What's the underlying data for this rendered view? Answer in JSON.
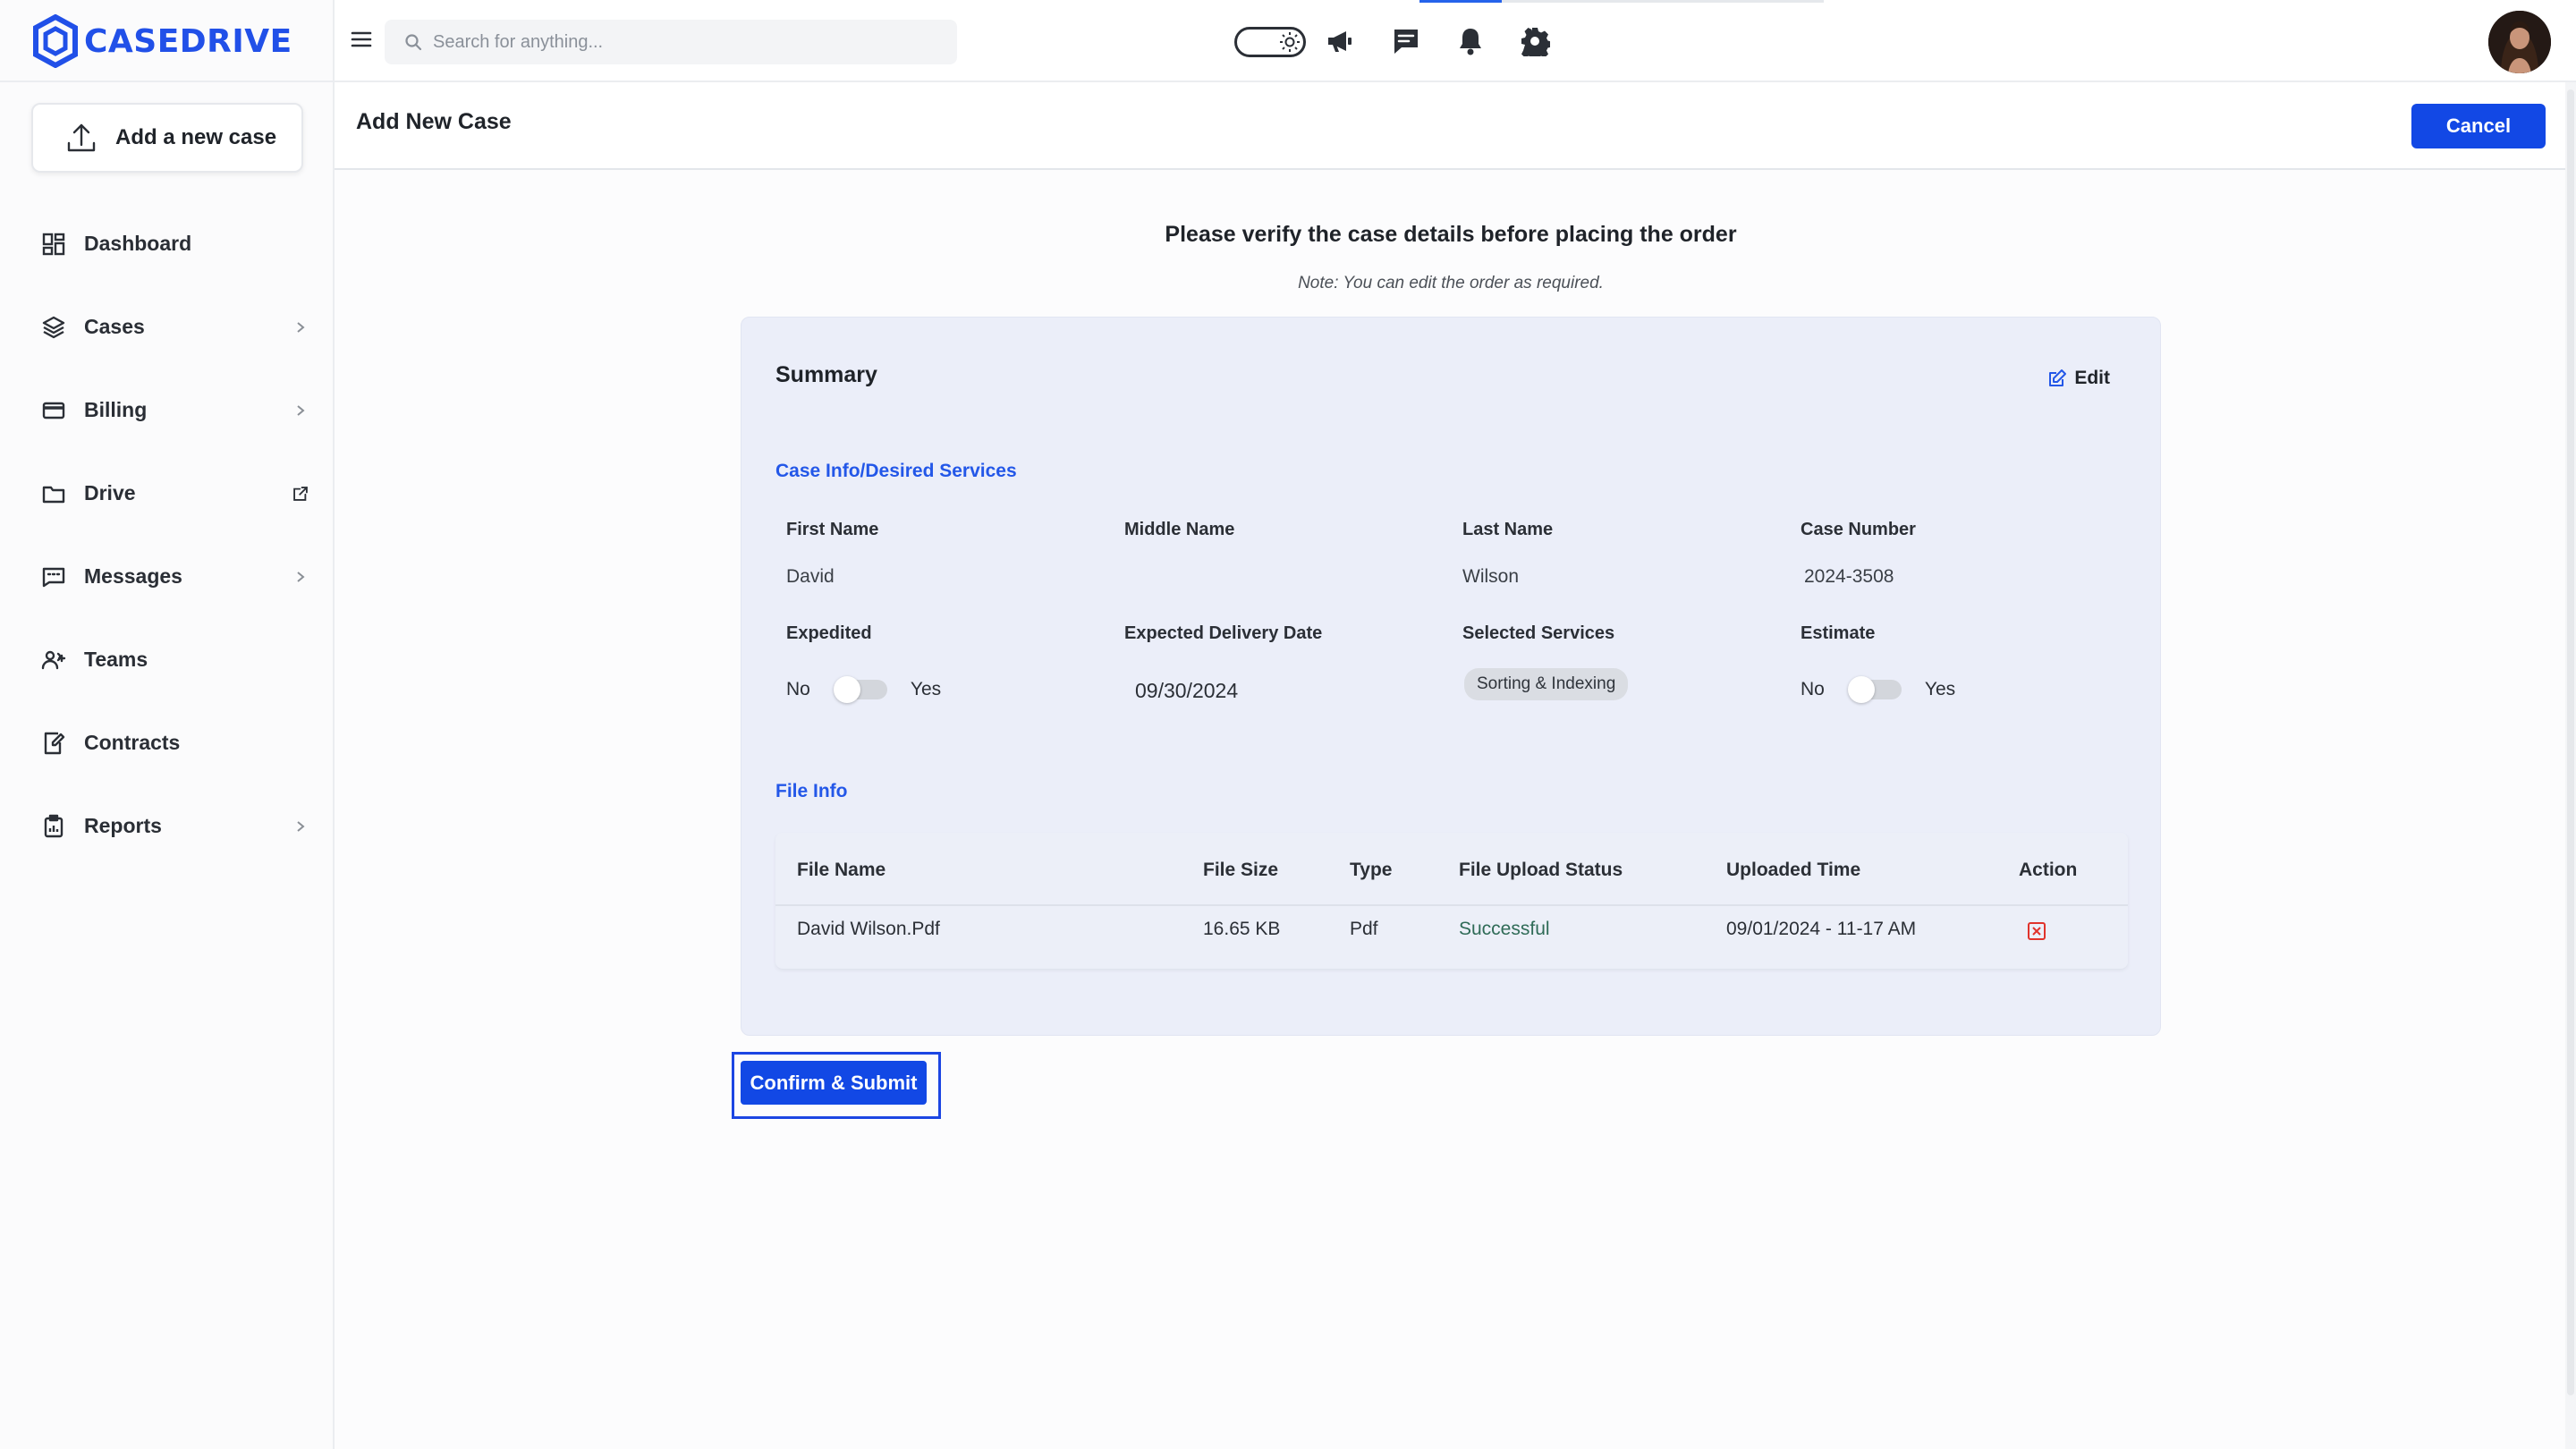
{
  "app": {
    "brand": "CASEDRIVE",
    "brand_color": "#2150e8",
    "accent": "#1248e5"
  },
  "sidebar": {
    "add_case_label": "Add a new case",
    "items": [
      {
        "label": "Dashboard",
        "icon": "dashboard-grid-icon",
        "has_chevron": false
      },
      {
        "label": "Cases",
        "icon": "layers-icon",
        "has_chevron": true
      },
      {
        "label": "Billing",
        "icon": "credit-card-icon",
        "has_chevron": true
      },
      {
        "label": "Drive",
        "icon": "folder-icon",
        "has_external_link": true
      },
      {
        "label": "Messages",
        "icon": "message-icon",
        "has_chevron": true
      },
      {
        "label": "Teams",
        "icon": "users-icon",
        "has_chevron": false
      },
      {
        "label": "Contracts",
        "icon": "contract-edit-icon",
        "has_chevron": false
      },
      {
        "label": "Reports",
        "icon": "clipboard-icon",
        "has_chevron": true
      }
    ]
  },
  "topbar": {
    "search_placeholder": "Search for anything...",
    "icons": [
      "menu-icon",
      "search-icon",
      "theme-toggle",
      "megaphone-icon",
      "chat-icon",
      "bell-icon",
      "gear-icon",
      "avatar"
    ]
  },
  "page": {
    "title": "Add New Case",
    "cancel_label": "Cancel",
    "headline": "Please verify the case details before placing the order",
    "note": "Note: You can edit the order as required."
  },
  "summary": {
    "title": "Summary",
    "edit_label": "Edit",
    "case_section_label": "Case Info/Desired Services",
    "fields": {
      "first_name_label": "First Name",
      "first_name": "David",
      "middle_name_label": "Middle Name",
      "middle_name": "",
      "last_name_label": "Last Name",
      "last_name": "Wilson",
      "case_number_label": "Case Number",
      "case_number": "2024-3508",
      "expedited_label": "Expedited",
      "expedited_no": "No",
      "expedited_yes": "Yes",
      "delivery_date_label": "Expected Delivery Date",
      "delivery_date": "09/30/2024",
      "services_label": "Selected Services",
      "service_chip": "Sorting & Indexing",
      "estimate_label": "Estimate",
      "estimate_no": "No",
      "estimate_yes": "Yes"
    },
    "file_section_label": "File Info",
    "file_table": {
      "headers": [
        "File Name",
        "File Size",
        "Type",
        "File Upload Status",
        "Uploaded Time",
        "Action"
      ],
      "rows": [
        {
          "name": "David Wilson.Pdf",
          "size": "16.65 KB",
          "type": "Pdf",
          "status": "Successful",
          "uploaded": "09/01/2024 - 11-17 AM"
        }
      ]
    }
  },
  "confirm_label": "Confirm & Submit"
}
